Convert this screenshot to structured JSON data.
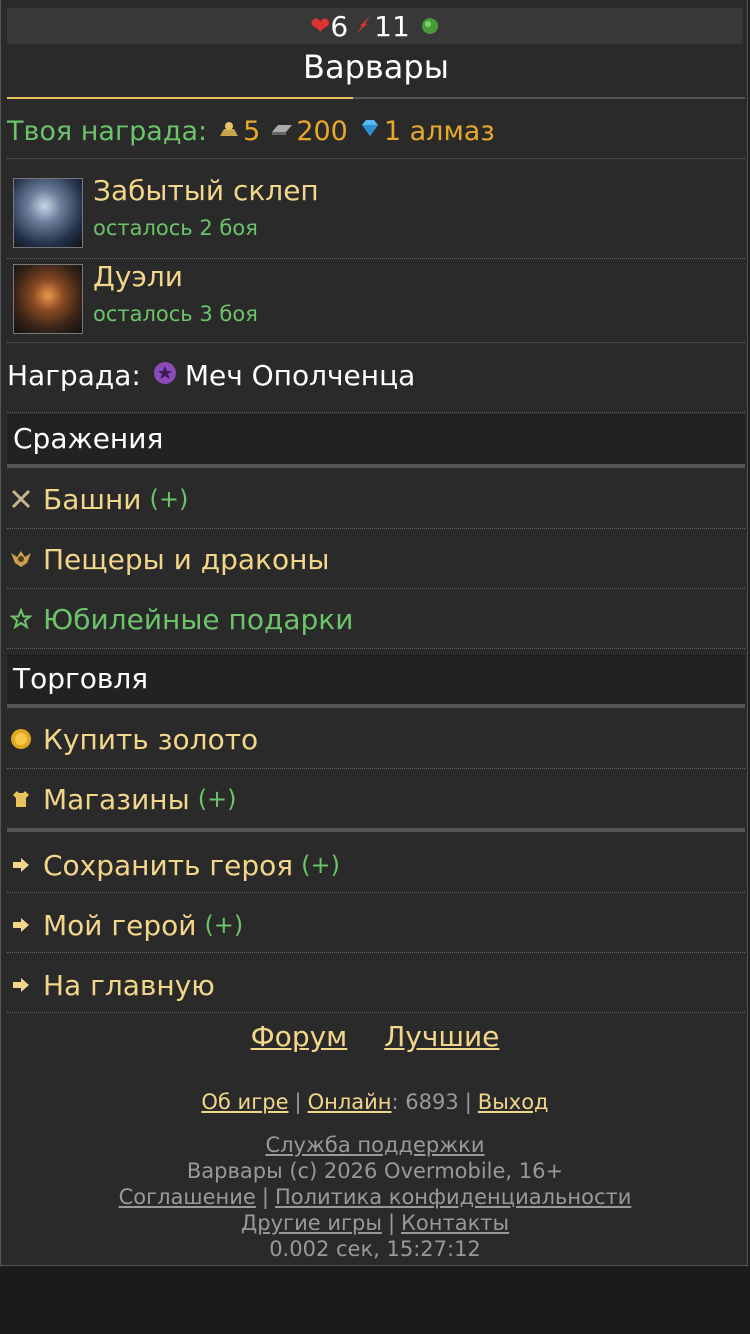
{
  "topbar": {
    "hearts": "6",
    "energy": "11"
  },
  "title": "Варвары",
  "reward": {
    "label": "Твоя награда:",
    "gold": "5",
    "iron": "200",
    "gems": "1 алмаз"
  },
  "quests": [
    {
      "name": "Забытый склеп",
      "remaining": "осталось 2 боя"
    },
    {
      "name": "Дуэли",
      "remaining": "осталось 3 боя"
    }
  ],
  "prize": {
    "label": "Награда:",
    "item": "Меч Ополченца"
  },
  "sections": {
    "battles": "Сражения",
    "trade": "Торговля"
  },
  "battles": [
    {
      "label": "Башни",
      "plus": "(+)"
    },
    {
      "label": "Пещеры и драконы"
    },
    {
      "label": "Юбилейные подарки"
    }
  ],
  "trade": [
    {
      "label": "Купить золото"
    },
    {
      "label": "Магазины",
      "plus": "(+)"
    }
  ],
  "nav": [
    {
      "label": "Сохранить героя",
      "plus": "(+)"
    },
    {
      "label": "Мой герой",
      "plus": "(+)"
    },
    {
      "label": "На главную"
    }
  ],
  "footer": {
    "forum": "Форум",
    "best": "Лучшие",
    "about": "Об игре",
    "online_label": "Онлайн",
    "online_count": ": 6893",
    "exit": "Выход",
    "support": "Служба поддержки",
    "copyright": "Варвары (c) 2026 Overmobile, 16+",
    "agreement": "Соглашение",
    "privacy": "Политика конфиденциальности",
    "other_games": "Другие игры",
    "contacts": "Контакты",
    "timing": "0.002 сек, 15:27:12"
  },
  "colors": {
    "accent": "#e8c25a",
    "link": "#f2d68a",
    "green": "#6cc36a",
    "gold": "#e8a929",
    "background": "#2a2a2a"
  }
}
